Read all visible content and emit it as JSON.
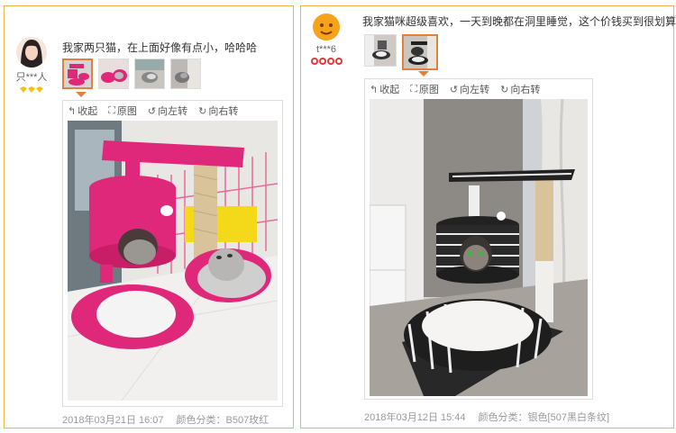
{
  "reviews": [
    {
      "username": "只***人",
      "text": "我家两只猫，在上面好像有点小，哈哈哈",
      "toolbar": {
        "collapse": "收起",
        "original": "原图",
        "rotate_left": "向左转",
        "rotate_right": "向右转"
      },
      "date": "2018年03月21日 16:07",
      "color_label": "颜色分类：",
      "color_value": "B507玫红",
      "colors": {
        "product": "#e0287a"
      }
    },
    {
      "username": "t***6",
      "text": "我家猫咪超级喜欢，一天到晚都在洞里睡觉，这个价钱买到很划算，",
      "toolbar": {
        "collapse": "收起",
        "original": "原图",
        "rotate_left": "向左转",
        "rotate_right": "向右转"
      },
      "date": "2018年03月12日 15:44",
      "color_label": "颜色分类：",
      "color_value": "银色[507黑白条纹]",
      "colors": {
        "product": "#222222"
      }
    }
  ],
  "icons": {
    "collapse": "collapse-icon",
    "original": "fullscreen-icon",
    "rotate_left": "rotate-left-icon",
    "rotate_right": "rotate-right-icon"
  },
  "accent": "#f0b24b",
  "active_thumb": "#e4803d"
}
